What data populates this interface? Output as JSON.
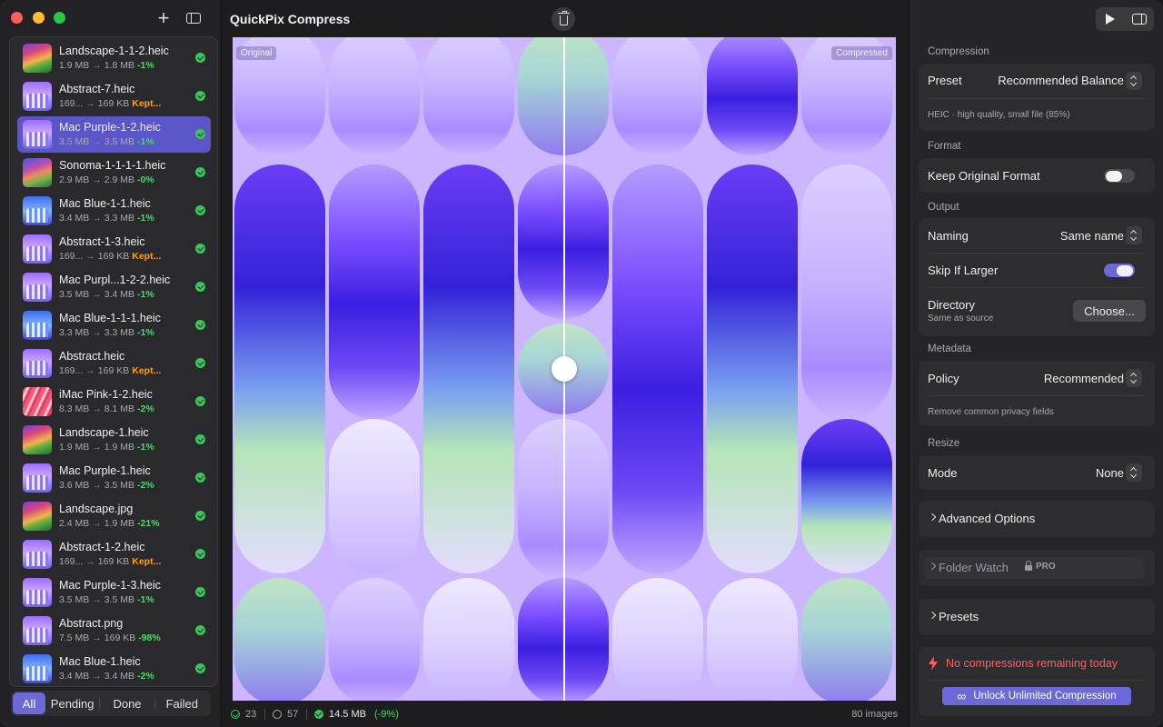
{
  "app": {
    "title": "QuickPix Compress"
  },
  "sidebar": {
    "add_glyph": "+",
    "files": [
      {
        "name": "Landscape-1-1-2.heic",
        "from": "1.9 MB",
        "to": "1.8 MB",
        "change": "-1%",
        "status": "green",
        "thumb": "landscape"
      },
      {
        "name": "Abstract-7.heic",
        "from": "169...",
        "to": "169 KB",
        "change": "Kept...",
        "status": "orange",
        "thumb": "abstract"
      },
      {
        "name": "Mac Purple-1-2.heic",
        "from": "3.5 MB",
        "to": "3.5 MB",
        "change": "-1%",
        "status": "green",
        "thumb": "abstract",
        "selected": true
      },
      {
        "name": "Sonoma-1-1-1-1.heic",
        "from": "2.9 MB",
        "to": "2.9 MB",
        "change": "-0%",
        "status": "green",
        "thumb": "sonoma"
      },
      {
        "name": "Mac Blue-1-1.heic",
        "from": "3.4 MB",
        "to": "3.3 MB",
        "change": "-1%",
        "status": "green",
        "thumb": "blue"
      },
      {
        "name": "Abstract-1-3.heic",
        "from": "169...",
        "to": "169 KB",
        "change": "Kept...",
        "status": "orange",
        "thumb": "abstract"
      },
      {
        "name": "Mac Purpl...1-2-2.heic",
        "from": "3.5 MB",
        "to": "3.4 MB",
        "change": "-1%",
        "status": "green",
        "thumb": "abstract"
      },
      {
        "name": "Mac Blue-1-1-1.heic",
        "from": "3.3 MB",
        "to": "3.3 MB",
        "change": "-1%",
        "status": "green",
        "thumb": "blue"
      },
      {
        "name": "Abstract.heic",
        "from": "169...",
        "to": "169 KB",
        "change": "Kept...",
        "status": "orange",
        "thumb": "abstract"
      },
      {
        "name": "iMac Pink-1-2.heic",
        "from": "8.3 MB",
        "to": "8.1 MB",
        "change": "-2%",
        "status": "green",
        "thumb": "pink"
      },
      {
        "name": "Landscape-1.heic",
        "from": "1.9 MB",
        "to": "1.9 MB",
        "change": "-1%",
        "status": "green",
        "thumb": "landscape"
      },
      {
        "name": "Mac Purple-1.heic",
        "from": "3.6 MB",
        "to": "3.5 MB",
        "change": "-2%",
        "status": "green",
        "thumb": "abstract"
      },
      {
        "name": "Landscape.jpg",
        "from": "2.4 MB",
        "to": "1.9 MB",
        "change": "-21%",
        "status": "green",
        "thumb": "landscape"
      },
      {
        "name": "Abstract-1-2.heic",
        "from": "169...",
        "to": "169 KB",
        "change": "Kept...",
        "status": "orange",
        "thumb": "abstract"
      },
      {
        "name": "Mac Purple-1-3.heic",
        "from": "3.5 MB",
        "to": "3.5 MB",
        "change": "-1%",
        "status": "green",
        "thumb": "abstract"
      },
      {
        "name": "Abstract.png",
        "from": "7.5 MB",
        "to": "169 KB",
        "change": "-98%",
        "status": "green",
        "thumb": "abstract"
      },
      {
        "name": "Mac Blue-1.heic",
        "from": "3.4 MB",
        "to": "3.4 MB",
        "change": "-2%",
        "status": "green",
        "thumb": "blue"
      }
    ],
    "filters": [
      "All",
      "Pending",
      "Done",
      "Failed"
    ],
    "active_filter": "All"
  },
  "preview": {
    "original_label": "Original",
    "compressed_label": "Compressed",
    "split_position": 0.5
  },
  "status": {
    "done_count": "23",
    "pending_count": "57",
    "saved_size": "14.5 MB",
    "saved_pct": "(-9%)",
    "image_count": "80 images"
  },
  "panel": {
    "compression": {
      "section": "Compression",
      "preset_label": "Preset",
      "preset_value": "Recommended Balance",
      "preset_hint": "HEIC · high quality, small file (85%)"
    },
    "format": {
      "section": "Format",
      "keep_original_label": "Keep Original Format",
      "keep_original_on": false
    },
    "output": {
      "section": "Output",
      "naming_label": "Naming",
      "naming_value": "Same name",
      "skip_label": "Skip If Larger",
      "skip_on": true,
      "directory_label": "Directory",
      "directory_sub": "Same as source",
      "choose_label": "Choose..."
    },
    "metadata": {
      "section": "Metadata",
      "policy_label": "Policy",
      "policy_value": "Recommended",
      "policy_hint": "Remove common privacy fields"
    },
    "resize": {
      "section": "Resize",
      "mode_label": "Mode",
      "mode_value": "None"
    },
    "advanced_label": "Advanced Options",
    "folder_watch_label": "Folder Watch",
    "pro_label": "PRO",
    "presets_label": "Presets",
    "limit_text": "No compressions remaining today",
    "unlock_label": "Unlock Unlimited Compression"
  },
  "colors": {
    "accent": "#6b68d8",
    "success": "#4cd964",
    "warning": "#ff9f0a",
    "danger": "#ff6159"
  },
  "icons": [
    "close-icon",
    "minimize-icon",
    "zoom-icon",
    "plus-icon",
    "sidebar-icon",
    "trash-icon",
    "play-icon",
    "inspector-icon",
    "check-circle-icon",
    "lock-icon",
    "bolt-icon",
    "infinity-icon",
    "chevron-right-icon",
    "stepper-icon"
  ]
}
